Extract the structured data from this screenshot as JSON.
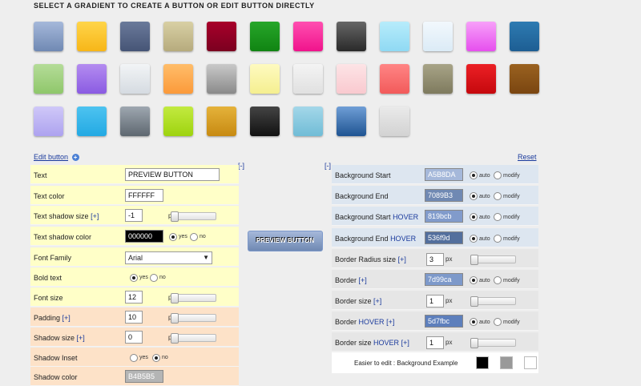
{
  "page_title": "SELECT A GRADIENT TO CREATE A BUTTON OR EDIT BUTTON DIRECTLY",
  "gradients": [
    [
      "#a5b8da",
      "#7089b3"
    ],
    [
      "#ffd54a",
      "#f7b618"
    ],
    [
      "#6a7a9a",
      "#465576"
    ],
    [
      "#d8d0a4",
      "#b6ab7d"
    ],
    [
      "#a8002a",
      "#7b0020"
    ],
    [
      "#27a62a",
      "#108412"
    ],
    [
      "#ff4fb0",
      "#f0138c"
    ],
    [
      "#666666",
      "#2a2a2a"
    ],
    [
      "#b7ecfb",
      "#8fd9f3"
    ],
    [
      "#f2f8fd",
      "#dbebf6"
    ],
    [
      "#f7a0f9",
      "#e64fee"
    ],
    [
      "#2e7bb2",
      "#1d5e93"
    ],
    [
      "#b5dc98",
      "#8fc76b"
    ],
    [
      "#b48cf0",
      "#8a5be2"
    ],
    [
      "#f2f4f6",
      "#d5dbe1"
    ],
    [
      "#ffbd6a",
      "#fb9a3a"
    ],
    [
      "#c9c9c9",
      "#8a8a8a"
    ],
    [
      "#fefac0",
      "#f5ef90"
    ],
    [
      "#f4f4f4",
      "#e0e0e0"
    ],
    [
      "#fde4e6",
      "#f9c9cf"
    ],
    [
      "#ff8585",
      "#f25a5a"
    ],
    [
      "#a8a487",
      "#7e7a5e"
    ],
    [
      "#ec2025",
      "#c5080d"
    ],
    [
      "#9a6220",
      "#7a4510"
    ],
    [
      "#cfc8f8",
      "#ada2ef"
    ],
    [
      "#4dc3f0",
      "#23a9e3"
    ],
    [
      "#9ea7b0",
      "#5e6770"
    ],
    [
      "#c2ea40",
      "#9ed30f"
    ],
    [
      "#e5b23a",
      "#c78a12"
    ],
    [
      "#444444",
      "#111111"
    ],
    [
      "#a4d7e9",
      "#70bcd6"
    ],
    [
      "#6f9ed6",
      "#1f5492"
    ],
    [
      "#eaeaea",
      "#d2d2d2"
    ]
  ],
  "links": {
    "edit_button": "Edit button",
    "reset": "Reset",
    "collapse_left": "[-]",
    "collapse_right": "[-]"
  },
  "plus_symbol": "+",
  "left_panel": {
    "text_label": "Text",
    "text_value": "PREVIEW BUTTON",
    "text_color_label": "Text color",
    "text_color_value": "FFFFFF",
    "text_shadow_size_label": "Text shadow size",
    "text_shadow_size_value": "-1",
    "text_shadow_color_label": "Text shadow color",
    "text_shadow_color_value": "000000",
    "font_family_label": "Font Family",
    "font_family_value": "Arial",
    "bold_text_label": "Bold text",
    "font_size_label": "Font size",
    "font_size_value": "12",
    "padding_label": "Padding",
    "padding_value": "10",
    "shadow_size_label": "Shadow size",
    "shadow_size_value": "0",
    "shadow_inset_label": "Shadow Inset",
    "shadow_color_label": "Shadow color",
    "shadow_color_value": "B4B5B5"
  },
  "common": {
    "plus_bracket": "[+]",
    "px": "px",
    "yes": "yes",
    "no": "no",
    "auto": "auto",
    "modify": "modify",
    "dropdown_arrow": "▼"
  },
  "preview_button_label": "PREVIEW BUTTON",
  "right_panel": {
    "bg_start_label": "Background Start",
    "bg_start_value": "A5B8DA",
    "bg_end_label": "Background End",
    "bg_end_value": "7089B3",
    "bg_start_hover_label": "Background Start",
    "bg_start_hover_value": "819bcb",
    "bg_end_hover_label": "Background End",
    "bg_end_hover_value": "536f9d",
    "hover_word": "HOVER",
    "border_radius_label": "Border Radius size",
    "border_radius_value": "3",
    "border_label": "Border",
    "border_value": "7d99ca",
    "border_size_label": "Border size",
    "border_size_value": "1",
    "border_hover_label": "Border",
    "border_hover_value": "5d7fbc",
    "border_size_hover_label": "Border size",
    "border_size_hover_value": "1",
    "easier_label": "Easier to edit : Background Example"
  },
  "colors": {
    "bg_start": "#a5b8da",
    "bg_end": "#7089b3",
    "bg_start_hover": "#819bcb",
    "bg_end_hover": "#536f9d",
    "border": "#7d99ca",
    "border_hover": "#5d7fbc",
    "text_shadow": "#000000",
    "shadow_color": "#b4b5b5"
  },
  "background_examples": [
    "#000000",
    "#999999",
    "#ffffff"
  ]
}
